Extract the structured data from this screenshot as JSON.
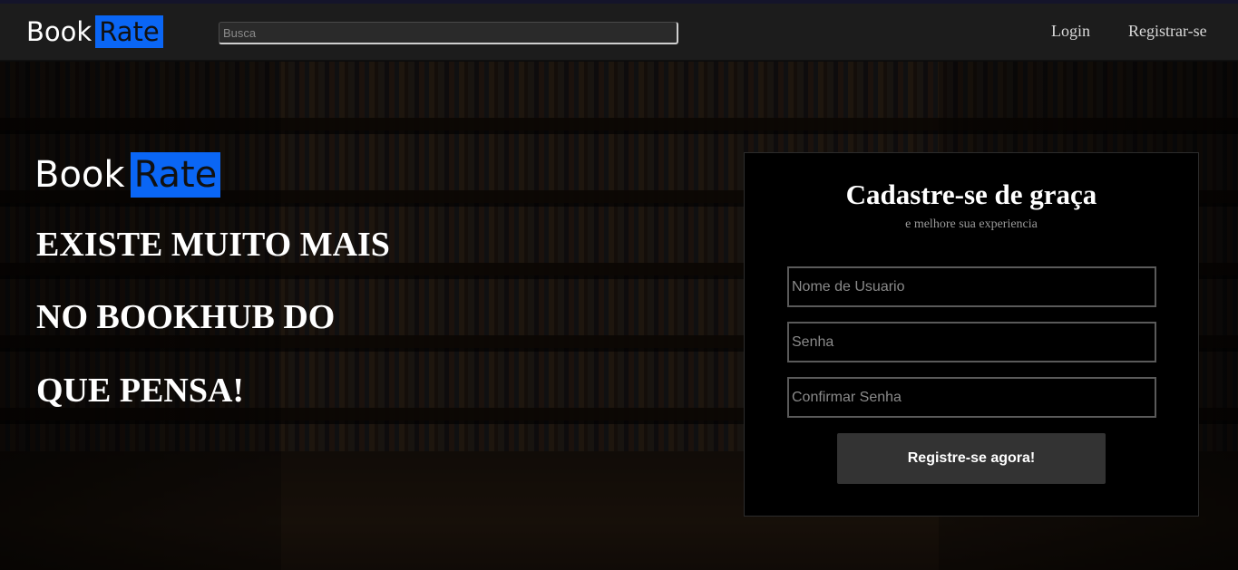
{
  "navbar": {
    "logo_book": "Book",
    "logo_rate": "Rate",
    "search_placeholder": "Busca",
    "login_label": "Login",
    "register_label": "Registrar-se"
  },
  "hero": {
    "logo_book": "Book",
    "logo_rate": "Rate",
    "headline_lines": [
      "EXISTE MUITO MAIS",
      "NO BOOKHUB DO",
      "QUE PENSA!"
    ]
  },
  "signup": {
    "title": "Cadastre-se de graça",
    "subtitle": "e melhore sua experiencia",
    "username_placeholder": "Nome de Usuario",
    "password_placeholder": "Senha",
    "confirm_placeholder": "Confirmar Senha",
    "submit_label": "Registre-se agora!"
  },
  "colors": {
    "accent": "#0a66f5",
    "navbar_bg": "#1c1c1c",
    "card_bg": "#000000",
    "button_bg": "#333333"
  }
}
